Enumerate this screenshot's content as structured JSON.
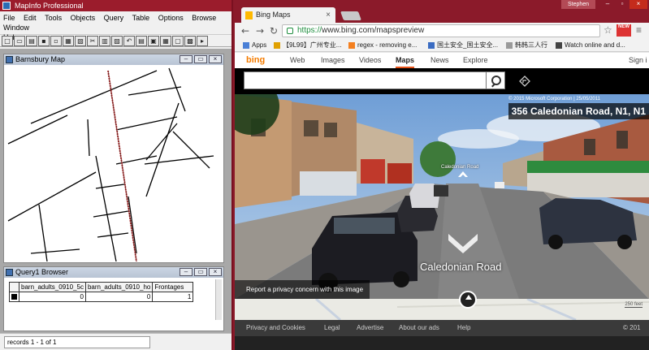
{
  "mapinfo": {
    "title": "MapInfo Professional",
    "menu": [
      "File",
      "Edit",
      "Tools",
      "Objects",
      "Query",
      "Table",
      "Options",
      "Browse",
      "Window",
      "Help"
    ],
    "map_window": {
      "title": "Barnsbury Map"
    },
    "browser_window": {
      "title": "Query1 Browser",
      "columns": [
        "barn_adults_0910_5c",
        "barn_adults_0910_ho",
        "Frontages"
      ],
      "row": [
        "0",
        "0",
        "1"
      ]
    },
    "status": "records 1 - 1 of 1"
  },
  "chrome": {
    "tab_title": "Bing Maps",
    "tab_close": "×",
    "profile": "Stephen",
    "url_scheme": "https://",
    "url_rest": "www.bing.com/mapspreview",
    "new_badge": "NEW",
    "bookmarks": [
      {
        "label": "Apps",
        "color": "#4a7fd6"
      },
      {
        "label": "【9L99】广州专业...",
        "color": "#e0a000"
      },
      {
        "label": "regex - removing e...",
        "color": "#f4801f"
      },
      {
        "label": "国土安全_国土安全...",
        "color": "#3b6cc2"
      },
      {
        "label": "韩韩三人行",
        "color": "#9a9a9a"
      },
      {
        "label": "Watch online and d...",
        "color": "#444444"
      }
    ]
  },
  "bing": {
    "logo": "bing",
    "nav": [
      "Web",
      "Images",
      "Videos",
      "Maps",
      "News",
      "Explore"
    ],
    "active_nav": "Maps",
    "sign_in": "Sign i",
    "copyright": "© 2015 Microsoft Corporation | 25/05/2011",
    "address_label": "356 Caledonian Road, N1, N1",
    "road_sign_small": "Caledonian Road",
    "road_sign_large": "Caledonian Road",
    "privacy": "Report a privacy concern with this image",
    "scale": "250 feet",
    "footer": [
      "Privacy and Cookies",
      "Legal",
      "Advertise",
      "About our ads",
      "Help",
      "© 201"
    ]
  }
}
